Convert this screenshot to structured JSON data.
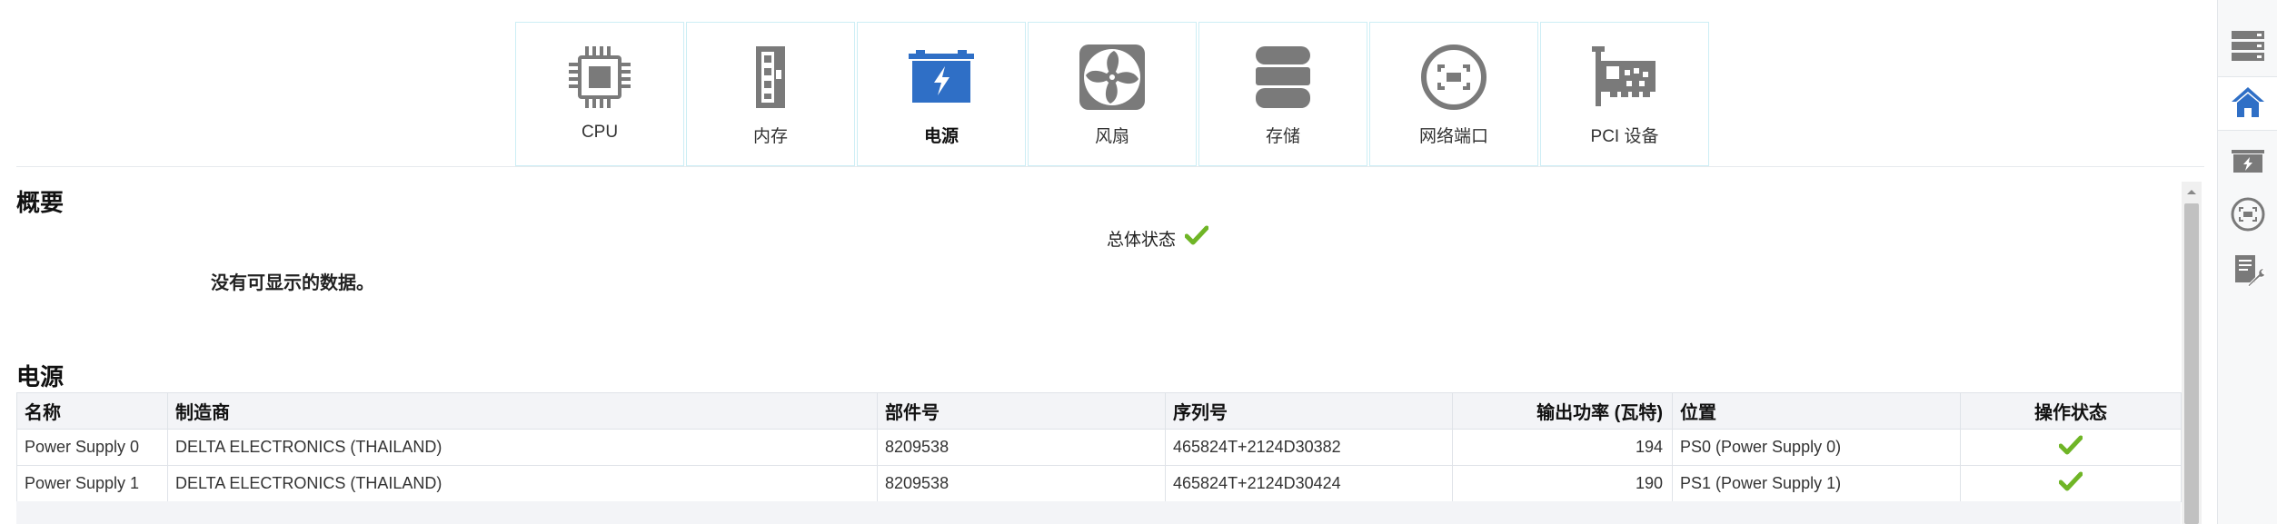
{
  "tiles": [
    {
      "label": "CPU",
      "icon": "cpu-icon"
    },
    {
      "label": "内存",
      "icon": "memory-icon"
    },
    {
      "label": "电源",
      "icon": "power-supply-icon",
      "active": true
    },
    {
      "label": "风扇",
      "icon": "fan-icon"
    },
    {
      "label": "存储",
      "icon": "storage-icon"
    },
    {
      "label": "网络端口",
      "icon": "network-port-icon"
    },
    {
      "label": "PCI 设备",
      "icon": "pci-card-icon"
    }
  ],
  "overview": {
    "title": "概要",
    "overall_status_label": "总体状态",
    "overall_status": "ok",
    "no_data": "没有可显示的数据。"
  },
  "power": {
    "title": "电源",
    "columns": [
      "名称",
      "制造商",
      "部件号",
      "序列号",
      "输出功率 (瓦特)",
      "位置",
      "操作状态"
    ],
    "rows": [
      {
        "name": "Power Supply 0",
        "manufacturer": "DELTA ELECTRONICS (THAILAND)",
        "part": "8209538",
        "serial": "465824T+2124D30382",
        "output": "194",
        "location": "PS0 (Power Supply 0)",
        "status": "ok"
      },
      {
        "name": "Power Supply 1",
        "manufacturer": "DELTA ELECTRONICS (THAILAND)",
        "part": "8209538",
        "serial": "465824T+2124D30424",
        "output": "190",
        "location": "PS1 (Power Supply 1)",
        "status": "ok"
      }
    ]
  },
  "rail": [
    "server-list-icon",
    "home-icon",
    "power-box-icon",
    "network-icon",
    "service-tools-icon"
  ],
  "colors": {
    "accent": "#2f6fc6",
    "icon_gray": "#7a7a7a",
    "ok_green": "#6fb526",
    "tile_border": "#cdeef5"
  }
}
